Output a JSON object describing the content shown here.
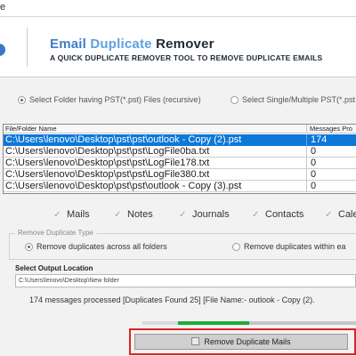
{
  "titlebar": {
    "text": "e"
  },
  "header": {
    "title_part1": "Email ",
    "title_part2": "Duplicate ",
    "title_part3": "Remover",
    "subtitle": "A QUICK DUPLICATE REMOVER TOOL TO REMOVE DUPLICATE EMAILS"
  },
  "source": {
    "option_folder": "Select Folder having PST(*.pst) Files (recursive)",
    "option_files": "Select Single/Multiple PST(*.pst",
    "selected": "option_folder"
  },
  "table": {
    "headers": [
      "File/Folder Name",
      "Messages Pro"
    ],
    "rows": [
      {
        "name": "C:\\Users\\lenovo\\Desktop\\pst\\pst\\outlook - Copy (2).pst",
        "messages": "174",
        "selected": true
      },
      {
        "name": "C:\\Users\\lenovo\\Desktop\\pst\\pst\\LogFile0ba.txt",
        "messages": "0",
        "selected": false
      },
      {
        "name": "C:\\Users\\lenovo\\Desktop\\pst\\pst\\LogFile178.txt",
        "messages": "0",
        "selected": false
      },
      {
        "name": "C:\\Users\\lenovo\\Desktop\\pst\\pst\\LogFile380.txt",
        "messages": "0",
        "selected": false
      },
      {
        "name": "C:\\Users\\lenovo\\Desktop\\pst\\pst\\outlook - Copy (3).pst",
        "messages": "0",
        "selected": false
      }
    ]
  },
  "categories": [
    {
      "label": "Mails",
      "checked": true
    },
    {
      "label": "Notes",
      "checked": true
    },
    {
      "label": "Journals",
      "checked": true
    },
    {
      "label": "Contacts",
      "checked": true
    },
    {
      "label": "Cale",
      "checked": true
    }
  ],
  "remove_type": {
    "title": "Remove Duplicate Type",
    "option_across": "Remove duplicates across all folders",
    "option_within": "Remove duplicates within ea",
    "selected": "option_across"
  },
  "output": {
    "label": "Select  Output Location",
    "path": "C:\\Users\\lenovo\\Desktop\\New folder"
  },
  "status": {
    "text": "174 messages processed [Duplicates Found 25]  [File Name:- outlook - Copy (2)."
  },
  "progress": {
    "value": 0.33
  },
  "action_button": {
    "label": "Remove Duplicate Mails"
  },
  "colors": {
    "accent": "#0c78d8",
    "brand_blue": "#3f7cc6",
    "progress": "#1eaa3a",
    "highlight_frame": "#e02222"
  }
}
